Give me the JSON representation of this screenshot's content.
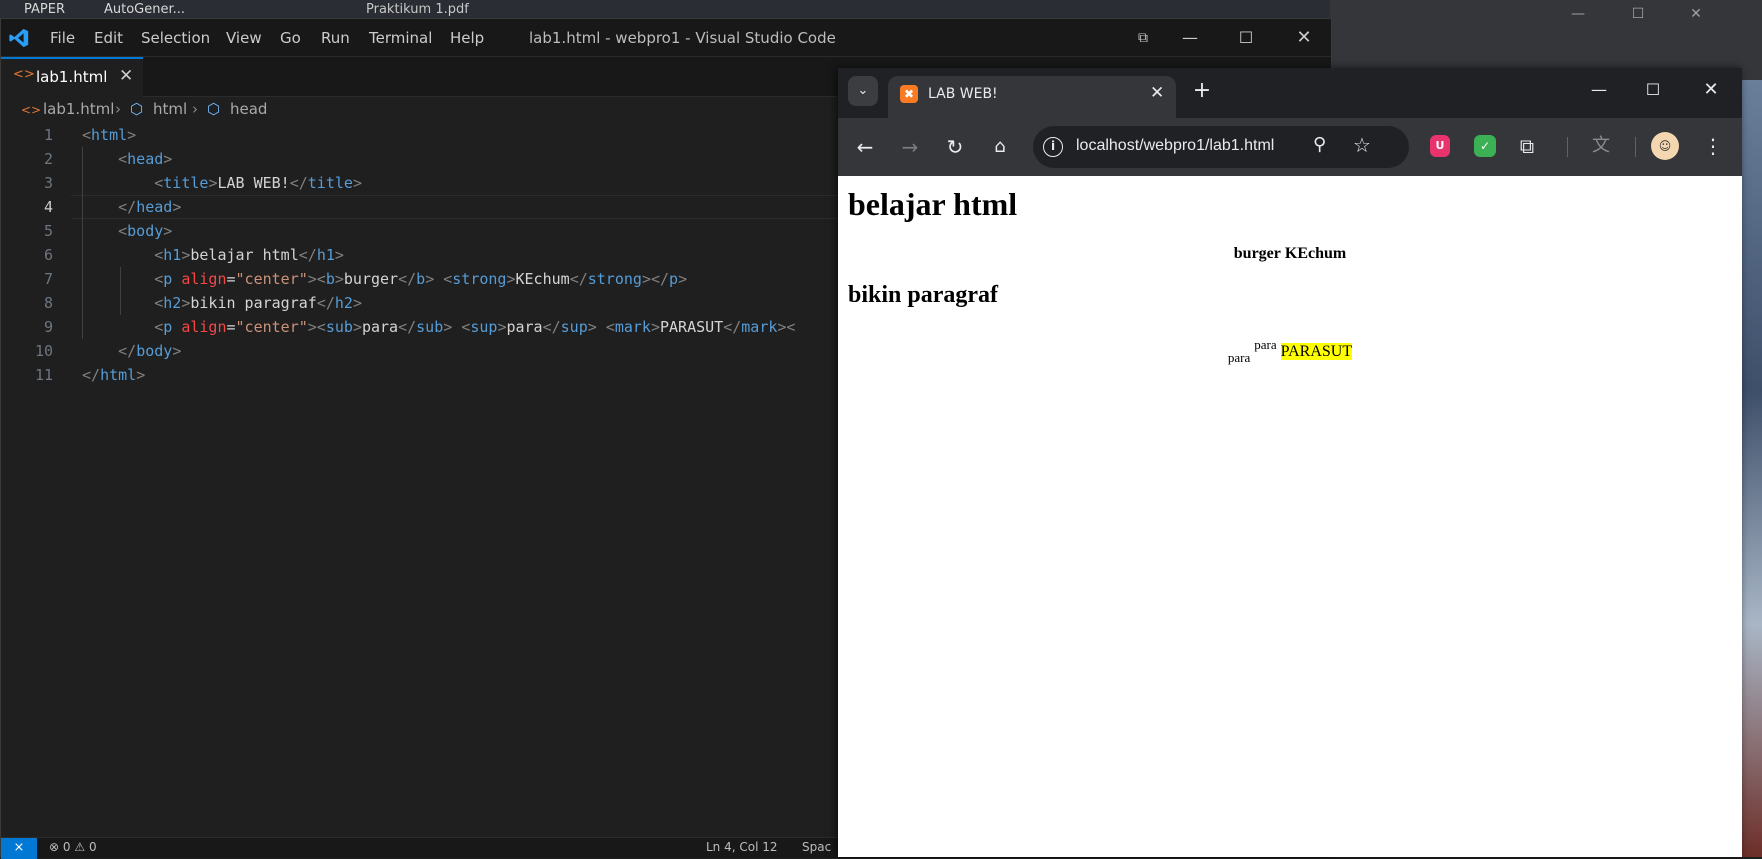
{
  "desktop": {
    "bg_tabs": [
      "PAPER",
      "AutoGener...",
      "Praktikum 1.pdf"
    ]
  },
  "vscode": {
    "menu": [
      "File",
      "Edit",
      "Selection",
      "View",
      "Go",
      "Run",
      "Terminal",
      "Help"
    ],
    "window_title": "lab1.html - webpro1 - Visual Studio Code",
    "tab_label": "lab1.html",
    "breadcrumb": [
      "lab1.html",
      "html",
      "head"
    ],
    "line_numbers": [
      "1",
      "2",
      "3",
      "4",
      "5",
      "6",
      "7",
      "8",
      "9",
      "10",
      "11"
    ],
    "current_line": 4,
    "status": {
      "problems": "0",
      "warnings": "0",
      "cursor": "Ln 4, Col 12",
      "spaces": "Spac"
    },
    "accent": "#0078d4"
  },
  "chrome": {
    "tab_title": "LAB WEB!",
    "url": "localhost/webpro1/lab1.html",
    "page": {
      "h1": "belajar html",
      "p1_bold": "burger",
      "p1_strong": "KEchum",
      "h2": "bikin paragraf",
      "sub": "para",
      "sup": "para",
      "mark": "PARASUT"
    }
  }
}
